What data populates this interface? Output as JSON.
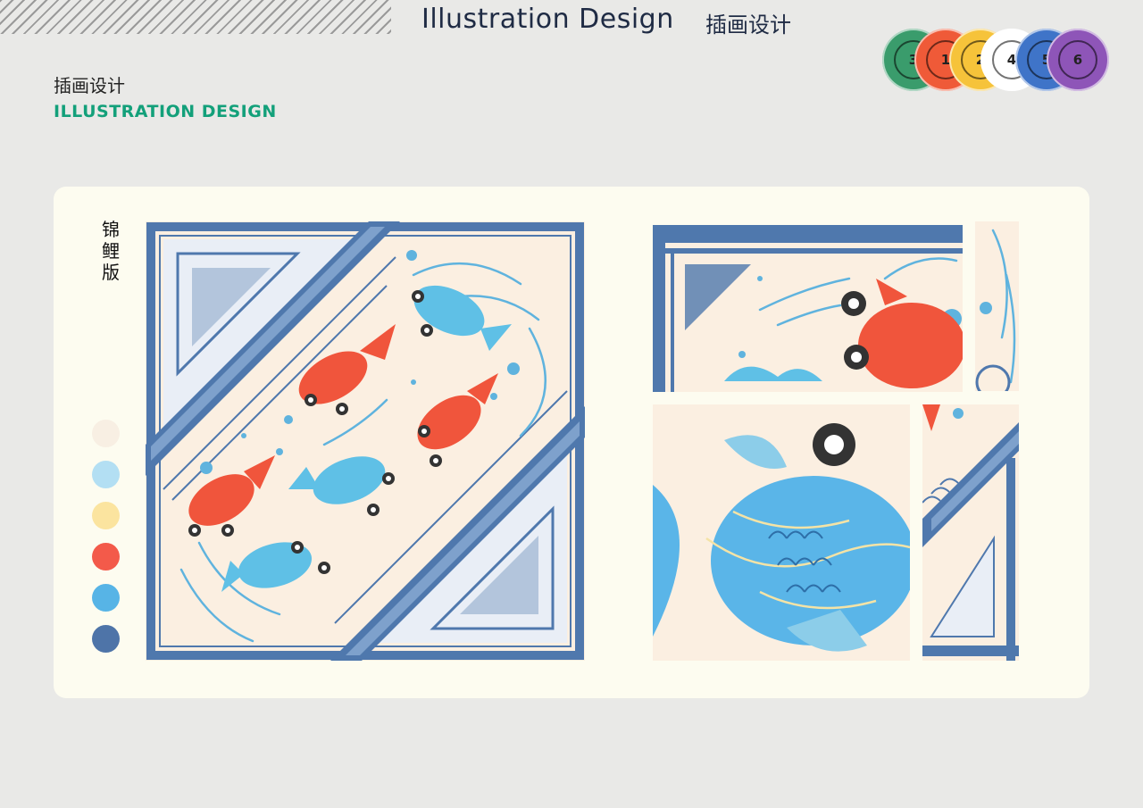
{
  "header": {
    "title": "Illustration Design",
    "title_cn": "插画设计"
  },
  "badges": [
    {
      "number": "3",
      "color": "#3a9c6c"
    },
    {
      "number": "1",
      "color": "#ef5a38"
    },
    {
      "number": "2",
      "color": "#f6c33a"
    },
    {
      "number": "4",
      "color": "#ffffff"
    },
    {
      "number": "5",
      "color": "#3f74c8"
    },
    {
      "number": "6",
      "color": "#8e55b8"
    }
  ],
  "section": {
    "title_cn": "插画设计",
    "title_en": "ILLUSTRATION DESIGN"
  },
  "card": {
    "label": "锦鲤版"
  },
  "palette": [
    "#f8efe3",
    "#b3dff3",
    "#fbe49f",
    "#f35a4a",
    "#57b4e6",
    "#4e74a8"
  ]
}
